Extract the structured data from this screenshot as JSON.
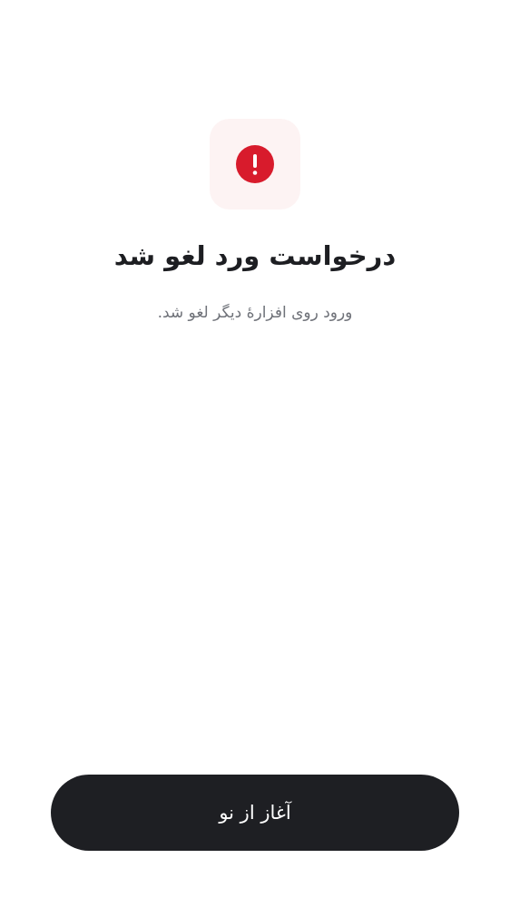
{
  "status": {
    "icon": "exclamation-circle-icon",
    "tile_color": "#fdf3f3",
    "icon_color": "#d81b2c"
  },
  "title": "درخواست ورد لغو شد",
  "subtitle": "ورود روی افزارهٔ دیگر لغو شد.",
  "restart_button": {
    "label": "آغاز از نو",
    "color": "#1e1f23"
  }
}
